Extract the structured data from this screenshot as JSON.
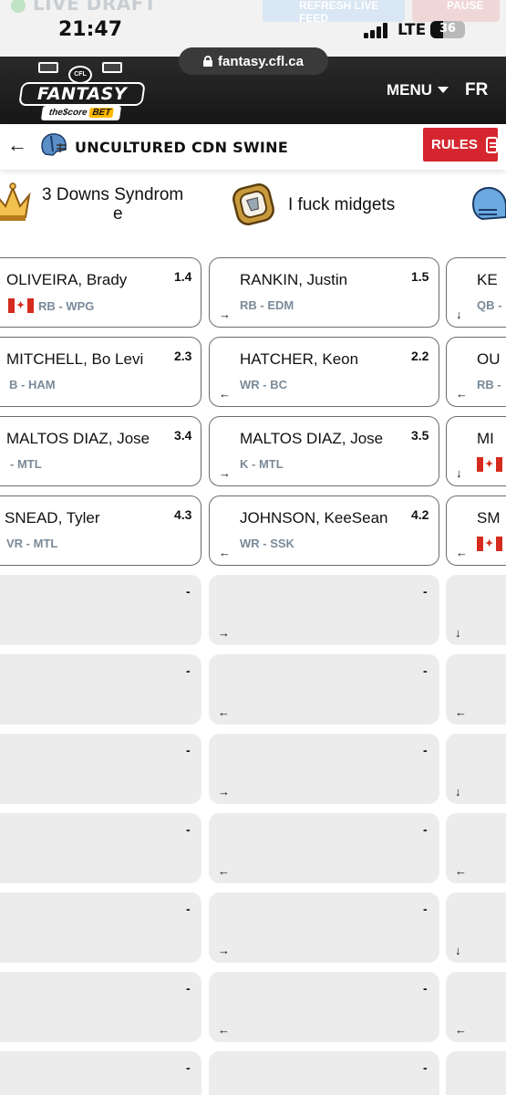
{
  "status_bar": {
    "ghost_live": "LIVE DRAFT",
    "ghost_refresh": "REFRESH LIVE FEED",
    "ghost_pause": "PAUSE",
    "time": "21:47",
    "carrier": "LTE",
    "battery": "36"
  },
  "header": {
    "url": "fantasy.cfl.ca",
    "logo_badge": "CFL",
    "logo_title": "FANTASY",
    "logo_sub_a": "the$core",
    "logo_sub_b": "BET",
    "menu_label": "MENU",
    "lang_label": "FR"
  },
  "team_bar": {
    "team_name": "UNCULTURED CDN SWINE",
    "rules_label": "RULES"
  },
  "columns": [
    {
      "name_line1": "3 Downs Syndrom",
      "name_line2": "e"
    },
    {
      "name_line1": "I fuck midgets",
      "name_line2": ""
    }
  ],
  "rows": [
    {
      "left": {
        "name": "OLIVEIRA, Brady",
        "pick": "1.4",
        "pos": "RB - WPG",
        "flag": true,
        "arrow": ""
      },
      "mid": {
        "name": "RANKIN, Justin",
        "pick": "1.5",
        "pos": "RB - EDM",
        "flag": false,
        "arrow": "→"
      },
      "right": {
        "name": "KE",
        "pos": "QB -",
        "flag": false,
        "arrow": "↓"
      }
    },
    {
      "left": {
        "name": "MITCHELL, Bo Levi",
        "pick": "2.3",
        "pos": "B - HAM",
        "flag": false,
        "arrow": ""
      },
      "mid": {
        "name": "HATCHER, Keon",
        "pick": "2.2",
        "pos": "WR - BC",
        "flag": false,
        "arrow": "←"
      },
      "right": {
        "name": "OU",
        "pos": "RB -",
        "flag": false,
        "arrow": "←"
      }
    },
    {
      "left": {
        "name": "MALTOS DIAZ, Jose",
        "pick": "3.4",
        "pos": "- MTL",
        "flag": false,
        "arrow": ""
      },
      "mid": {
        "name": "MALTOS DIAZ, Jose",
        "pick": "3.5",
        "pos": "K - MTL",
        "flag": false,
        "arrow": "→"
      },
      "right": {
        "name": "MI",
        "pos": "",
        "flag": true,
        "arrow": "↓"
      }
    },
    {
      "left": {
        "name": "SNEAD, Tyler",
        "pick": "4.3",
        "pos": "VR - MTL",
        "flag": false,
        "arrow": ""
      },
      "mid": {
        "name": "JOHNSON, KeeSean",
        "pick": "4.2",
        "pos": "WR - SSK",
        "flag": false,
        "arrow": "←"
      },
      "right": {
        "name": "SM",
        "pos": "",
        "flag": true,
        "arrow": "←"
      }
    }
  ],
  "empty_rows": [
    {
      "left_pick": "-",
      "mid_pick": "-",
      "mid_arrow": "→",
      "right_arrow": "↓"
    },
    {
      "left_pick": "-",
      "mid_pick": "-",
      "mid_arrow": "←",
      "right_arrow": "←"
    },
    {
      "left_pick": "-",
      "mid_pick": "-",
      "mid_arrow": "→",
      "right_arrow": "↓"
    },
    {
      "left_pick": "-",
      "mid_pick": "-",
      "mid_arrow": "←",
      "right_arrow": "←"
    },
    {
      "left_pick": "-",
      "mid_pick": "-",
      "mid_arrow": "→",
      "right_arrow": "↓"
    },
    {
      "left_pick": "-",
      "mid_pick": "-",
      "mid_arrow": "←",
      "right_arrow": "←"
    },
    {
      "left_pick": "-",
      "mid_pick": "-",
      "mid_arrow": "",
      "right_arrow": ""
    }
  ],
  "colors": {
    "header_bg": "#1d1d1d",
    "rules_red": "#d5262f",
    "pos_gray": "#7a8a99",
    "empty_card": "#ececec"
  }
}
